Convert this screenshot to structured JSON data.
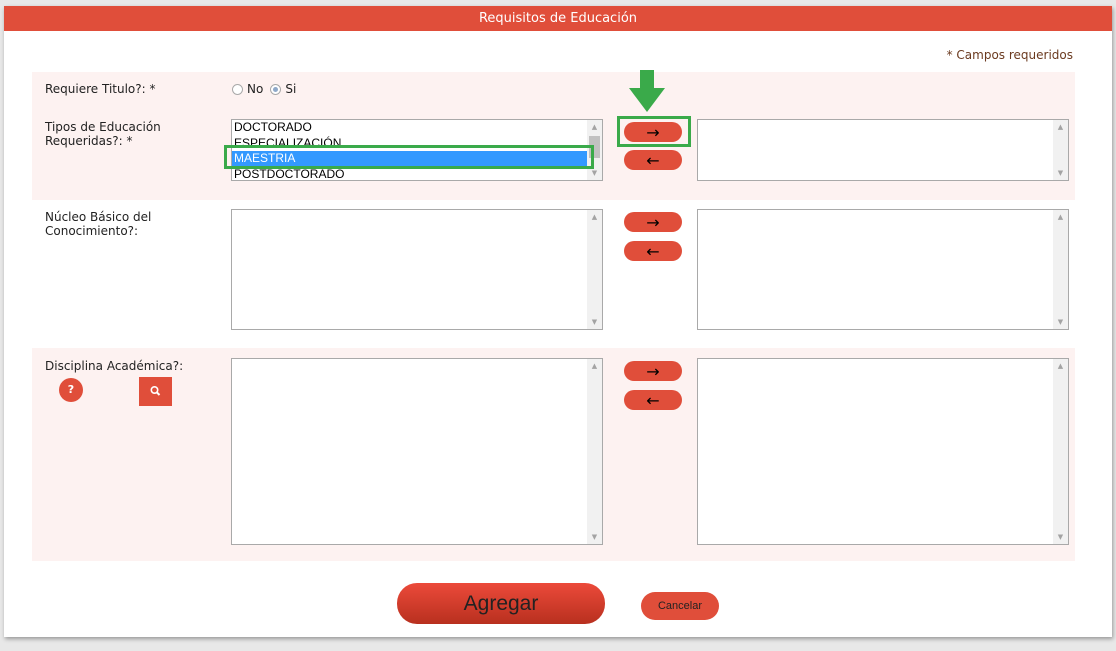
{
  "header": {
    "title": "Requisitos de Educación"
  },
  "required_note": "* Campos requeridos",
  "titulo": {
    "label": "Requiere Titulo?: *",
    "options": [
      {
        "label": "No",
        "checked": false
      },
      {
        "label": "Si",
        "checked": true
      }
    ]
  },
  "tipos": {
    "label_line1": "Tipos de Educación",
    "label_line2": "Requeridas?: *",
    "available": [
      "DOCTORADO",
      "ESPECIALIZACIÓN",
      "MAESTRIA",
      "POSTDOCTORADO"
    ],
    "selected_item": "MAESTRIA"
  },
  "nucleo": {
    "label_line1": "Núcleo Básico del",
    "label_line2": "Conocimiento?:"
  },
  "disciplina": {
    "label": "Disciplina Académica?:",
    "help_label": "?"
  },
  "buttons": {
    "add_symbol": "→",
    "remove_symbol": "←",
    "agregar": "Agregar",
    "cancelar": "Cancelar"
  },
  "colors": {
    "accent": "#e04e3a",
    "section_bg": "#fdf2f1",
    "selection": "#3399ff",
    "highlight": "#3aaa4a"
  }
}
